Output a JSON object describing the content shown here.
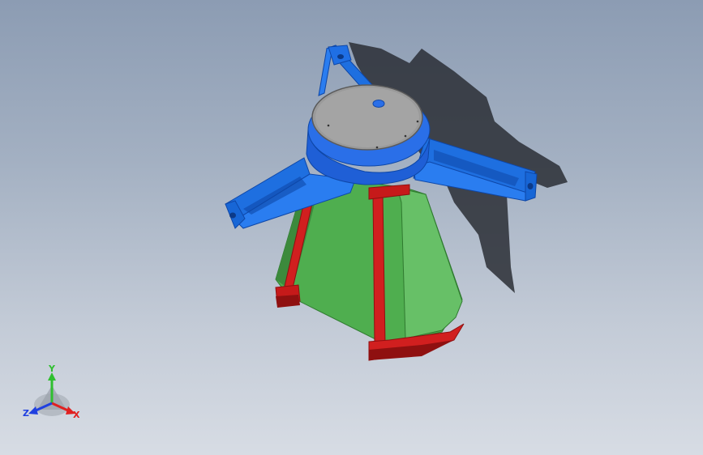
{
  "viewport": {
    "background_top": "#8c9cb3",
    "background_bottom": "#d7dce4"
  },
  "model": {
    "colors": {
      "bracket": "#1e6fe0",
      "bracket_dark": "#0e47a8",
      "hub_top": "#9a9a9a",
      "hub_ring": "#1f5fd6",
      "cone": "#4fae4f",
      "cone_dark": "#3c8a3c",
      "legs": "#d11f1f",
      "legs_dark": "#8f1010",
      "shadow": "#2a2e35"
    }
  },
  "triad": {
    "y_label": "Y",
    "x_label": "X",
    "z_label": "Z",
    "y_color": "#2fbf2f",
    "x_color": "#e02020",
    "z_color": "#2040e0"
  }
}
